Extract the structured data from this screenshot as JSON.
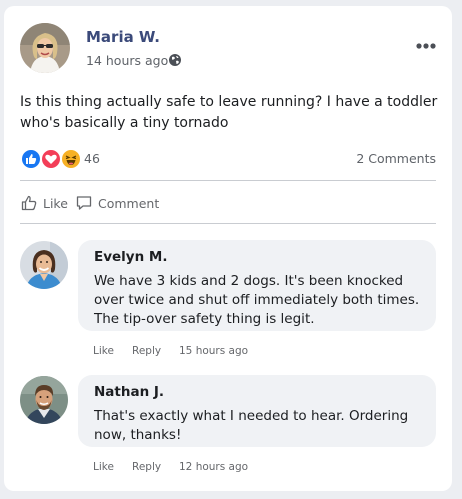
{
  "post": {
    "author": "Maria W.",
    "time": "14 hours ago",
    "privacy_icon": "globe-icon",
    "text": "Is this thing actually safe to leave running? I have a toddler who's basically a tiny tornado",
    "reactions": {
      "icons": [
        "like-icon",
        "love-icon",
        "haha-icon"
      ],
      "count": "46"
    },
    "comments_count": "2 Comments",
    "actions": {
      "like": "Like",
      "comment": "Comment"
    }
  },
  "comments": [
    {
      "author": "Evelyn M.",
      "text": "We have 3 kids and 2 dogs. It's been knocked over twice and shut off immediately both times. The tip-over safety thing is legit.",
      "like": "Like",
      "reply": "Reply",
      "time": "15 hours ago"
    },
    {
      "author": "Nathan J.",
      "text": "That's exactly what I needed to hear. Ordering now, thanks!",
      "like": "Like",
      "reply": "Reply",
      "time": "12 hours ago"
    }
  ],
  "colors": {
    "author": "#3b4a7a",
    "like_blue": "#1877f2",
    "love_red": "#f33e58",
    "haha_yellow": "#f7b125"
  }
}
